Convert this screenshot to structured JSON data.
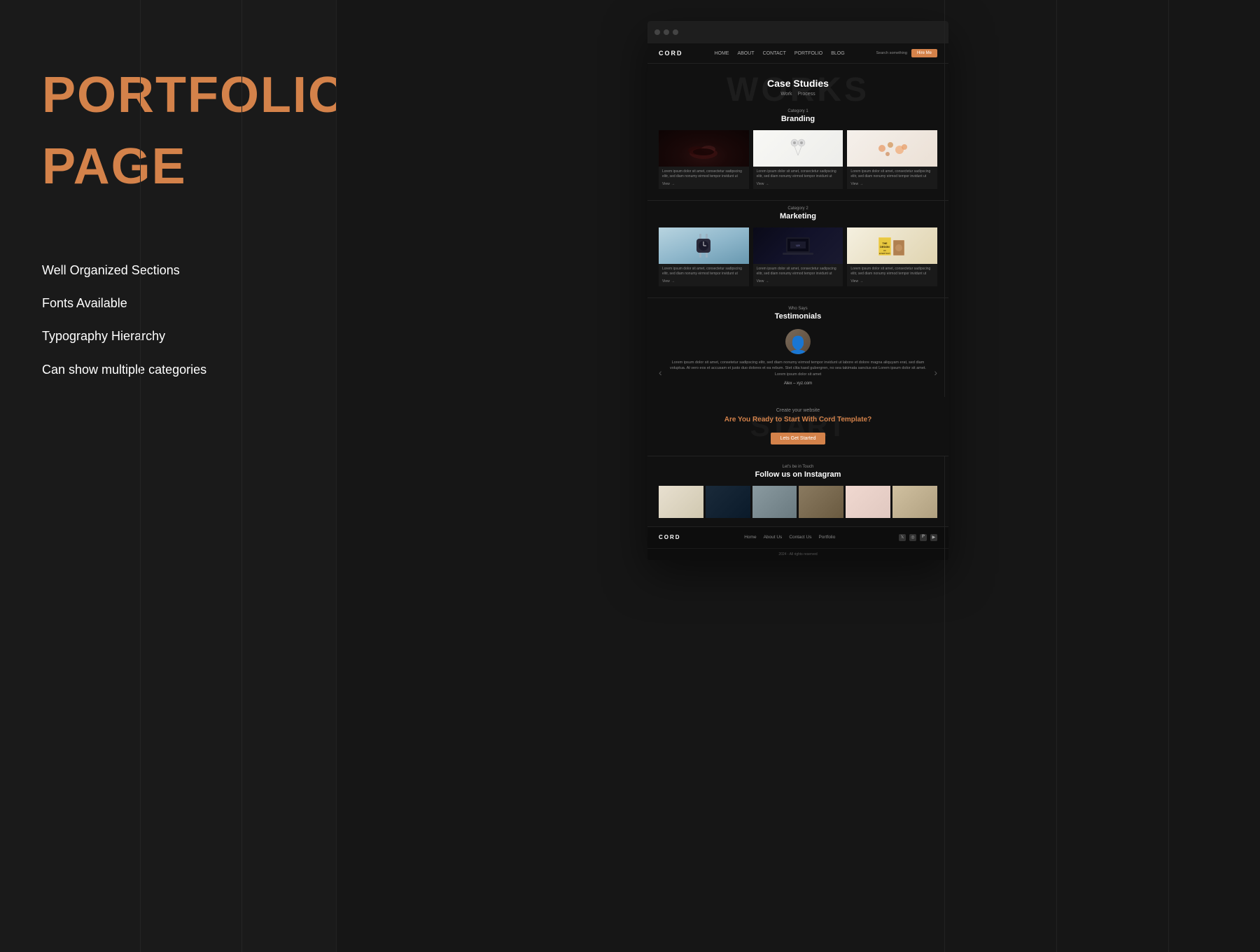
{
  "leftPanel": {
    "title_line1": "PORTFOLIO",
    "title_line2": "PAGE",
    "features": [
      "Well Organized Sections",
      "Fonts Available",
      "Typography Hierarchy",
      "Can show multiple categories"
    ]
  },
  "website": {
    "nav": {
      "logo": "CORD",
      "links": [
        "HOME",
        "ABOUT",
        "CONTACT",
        "PORTFOLIO",
        "BLOG"
      ],
      "search_placeholder": "Search something",
      "cta": "Hire Me"
    },
    "works": {
      "bg_text": "WORKS",
      "title": "Case Studies",
      "tabs": [
        "Work",
        "Process"
      ]
    },
    "category1": {
      "label": "Category 1",
      "title": "Branding",
      "projects": [
        {
          "desc": "Lorem ipsum dolor sit amet, consectetur sadipscing elitr, sed diam nonumy eirmod tempor invidunt ut",
          "link": "View"
        },
        {
          "desc": "Lorem ipsum dolor sit amet, consectetur sadipscing elitr, sed diam nonumy eirmod tempor invidunt ut",
          "link": "View"
        },
        {
          "desc": "Lorem ipsum dolor sit amet, consectetur sadipscing elitr, sed diam nonumy eirmod tempor invidunt ut",
          "link": "View"
        }
      ]
    },
    "category2": {
      "label": "Category 2",
      "title": "Marketing",
      "projects": [
        {
          "desc": "Lorem ipsum dolor sit amet, consectetur sadipscing elitr, sed diam nonumy eirmod tempor invidunt ut",
          "link": "View"
        },
        {
          "desc": "Lorem ipsum dolor sit amet, consectetur sadipscing elitr, sed diam nonumy eirmod tempor invidunt ut",
          "link": "View"
        },
        {
          "desc": "Lorem ipsum dolor sit amet, consectetur sadipscing elitr, sed diam nonumy eirmod tempor invidunt ut",
          "link": "View"
        }
      ]
    },
    "testimonials": {
      "label": "Who Says",
      "title": "Testimonials",
      "text": "Lorem ipsum dolor sit amet, consetetur sadipscing elitr, sed diam nonumy eirmod tempor invidunt ut labore et dolore magna aliquyam erat, sed diam voluptua. At vero eos et accusam et justo duo dolores et ea rebum. Stet clita kasd gubergren, no sea takimata sanctus est Lorem ipsum dolor sit amet. Lorem ipsum dolor sit amet",
      "author": "Alex – xyz.com"
    },
    "cta": {
      "label": "Create your website",
      "title": "Are You Ready to Start With Cord Template?",
      "bg_text": "START",
      "button": "Lets Get Started"
    },
    "instagram": {
      "label": "Let's be in Touch",
      "title": "Follow us on Instagram"
    },
    "footer": {
      "logo": "CORD",
      "links": [
        "Home",
        "About Us",
        "Contact Us",
        "Portfolio"
      ],
      "copyright": "2024 - All rights reserved"
    }
  },
  "colors": {
    "accent": "#d4824a",
    "background": "#1a1a1a",
    "text_primary": "#ffffff",
    "text_secondary": "#888888"
  }
}
